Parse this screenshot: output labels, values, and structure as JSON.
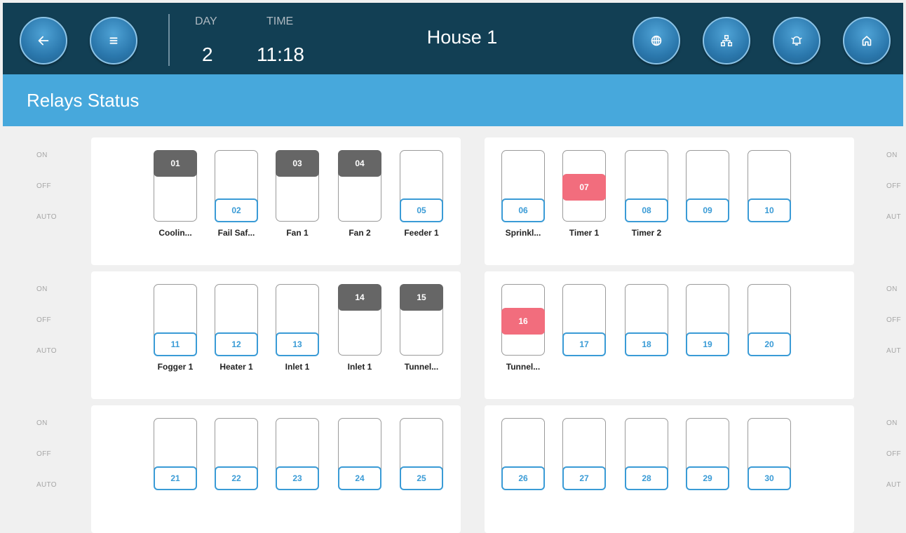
{
  "header": {
    "day_label": "DAY",
    "day_value": "2",
    "time_label": "TIME",
    "time_value": "11:18",
    "house_title": "House 1",
    "icons": [
      "back-arrow-icon",
      "menu-icon",
      "globe-icon",
      "network-icon",
      "alarm-bell-icon",
      "home-icon"
    ]
  },
  "page_title": "Relays Status",
  "side_labels": {
    "on": "ON",
    "off": "OFF",
    "auto": "AUTO"
  },
  "right_side_labels": {
    "on": "ON",
    "off": "OFF",
    "auto": "AUT"
  },
  "colors": {
    "on": "#666666",
    "off": "#f26d7d",
    "auto": "#3a9bd6",
    "header": "#123f54",
    "title_bar": "#47a8dc"
  },
  "relays": [
    {
      "num": "01",
      "state": "on",
      "name": "Coolin..."
    },
    {
      "num": "02",
      "state": "auto",
      "name": "Fail Saf..."
    },
    {
      "num": "03",
      "state": "on",
      "name": "Fan 1"
    },
    {
      "num": "04",
      "state": "on",
      "name": "Fan 2"
    },
    {
      "num": "05",
      "state": "auto",
      "name": "Feeder 1"
    },
    {
      "num": "06",
      "state": "auto",
      "name": "Sprinkl..."
    },
    {
      "num": "07",
      "state": "off",
      "name": "Timer 1"
    },
    {
      "num": "08",
      "state": "auto",
      "name": "Timer 2"
    },
    {
      "num": "09",
      "state": "auto",
      "name": ""
    },
    {
      "num": "10",
      "state": "auto",
      "name": ""
    },
    {
      "num": "11",
      "state": "auto",
      "name": "Fogger 1"
    },
    {
      "num": "12",
      "state": "auto",
      "name": "Heater 1"
    },
    {
      "num": "13",
      "state": "auto",
      "name": "Inlet 1"
    },
    {
      "num": "14",
      "state": "on",
      "name": "Inlet 1"
    },
    {
      "num": "15",
      "state": "on",
      "name": "Tunnel..."
    },
    {
      "num": "16",
      "state": "off",
      "name": "Tunnel..."
    },
    {
      "num": "17",
      "state": "auto",
      "name": ""
    },
    {
      "num": "18",
      "state": "auto",
      "name": ""
    },
    {
      "num": "19",
      "state": "auto",
      "name": ""
    },
    {
      "num": "20",
      "state": "auto",
      "name": ""
    },
    {
      "num": "21",
      "state": "auto",
      "name": ""
    },
    {
      "num": "22",
      "state": "auto",
      "name": ""
    },
    {
      "num": "23",
      "state": "auto",
      "name": ""
    },
    {
      "num": "24",
      "state": "auto",
      "name": ""
    },
    {
      "num": "25",
      "state": "auto",
      "name": ""
    },
    {
      "num": "26",
      "state": "auto",
      "name": ""
    },
    {
      "num": "27",
      "state": "auto",
      "name": ""
    },
    {
      "num": "28",
      "state": "auto",
      "name": ""
    },
    {
      "num": "29",
      "state": "auto",
      "name": ""
    },
    {
      "num": "30",
      "state": "auto",
      "name": ""
    }
  ]
}
